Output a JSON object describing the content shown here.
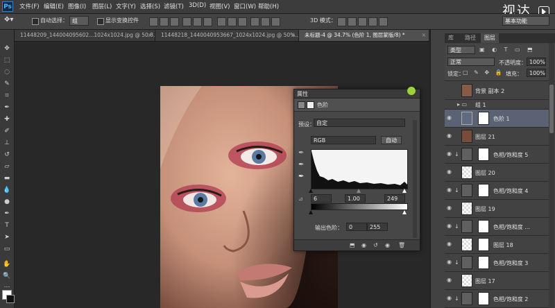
{
  "app": {
    "logo": "Ps",
    "watermark": "视达"
  },
  "menu": [
    "文件(F)",
    "编辑(E)",
    "图像(I)",
    "图层(L)",
    "文字(Y)",
    "选择(S)",
    "滤镜(T)",
    "3D(D)",
    "视图(V)",
    "窗口(W)",
    "帮助(H)"
  ],
  "options": {
    "auto_select_label": "自动选择：",
    "auto_select_value": "组",
    "show_transform_label": "显示变换控件",
    "mode_3d_label": "3D 模式：",
    "workspace_label": "基本功能"
  },
  "tabs": [
    {
      "label": "11448209_144004095602...1024x1024.jpg @ 50.8..."
    },
    {
      "label": "11448218_1440040953667_1024x1024.jpg @ 50%..."
    },
    {
      "label": "未标题-4 @ 34.7% (色阶 1, 图层蒙版/8) *",
      "active": true
    }
  ],
  "properties": {
    "title": "属性",
    "subtitle": "色阶",
    "preset_label": "预设：",
    "preset_value": "自定",
    "channel_value": "RGB",
    "auto_button": "自动",
    "input_black": "6",
    "input_gamma": "1.00",
    "input_white": "249",
    "output_label": "输出色阶：",
    "output_black": "0",
    "output_white": "255"
  },
  "panel_tabs": [
    "库",
    "路径",
    "图层"
  ],
  "layers_controls": {
    "kind_filter": "类型",
    "blend_mode": "正常",
    "opacity_label": "不透明度：",
    "opacity_value": "100%",
    "lock_label": "锁定：",
    "fill_label": "填充：",
    "fill_value": "100%"
  },
  "layers": [
    {
      "name": "背景 副本 2",
      "type": "photo",
      "visible": false
    },
    {
      "name": "组 1",
      "type": "group",
      "visible": false
    },
    {
      "name": "色阶 1",
      "type": "adjustment",
      "visible": true,
      "selected": true
    },
    {
      "name": "图层 21",
      "type": "photo",
      "visible": true
    },
    {
      "name": "色相/饱和度 5",
      "type": "hue-sat",
      "visible": true
    },
    {
      "name": "图层 20",
      "type": "pixel",
      "visible": true
    },
    {
      "name": "色相/饱和度 4",
      "type": "hue-sat",
      "visible": true
    },
    {
      "name": "图层 19",
      "type": "pixel",
      "visible": true
    },
    {
      "name": "色相/饱和度 ...",
      "type": "hue-sat",
      "visible": true
    },
    {
      "name": "图层 18",
      "type": "pixel",
      "visible": true
    },
    {
      "name": "色相/饱和度 3",
      "type": "hue-sat",
      "visible": true
    },
    {
      "name": "图层 17",
      "type": "pixel",
      "visible": true
    },
    {
      "name": "色相/饱和度 2",
      "type": "hue-sat",
      "visible": true
    }
  ]
}
